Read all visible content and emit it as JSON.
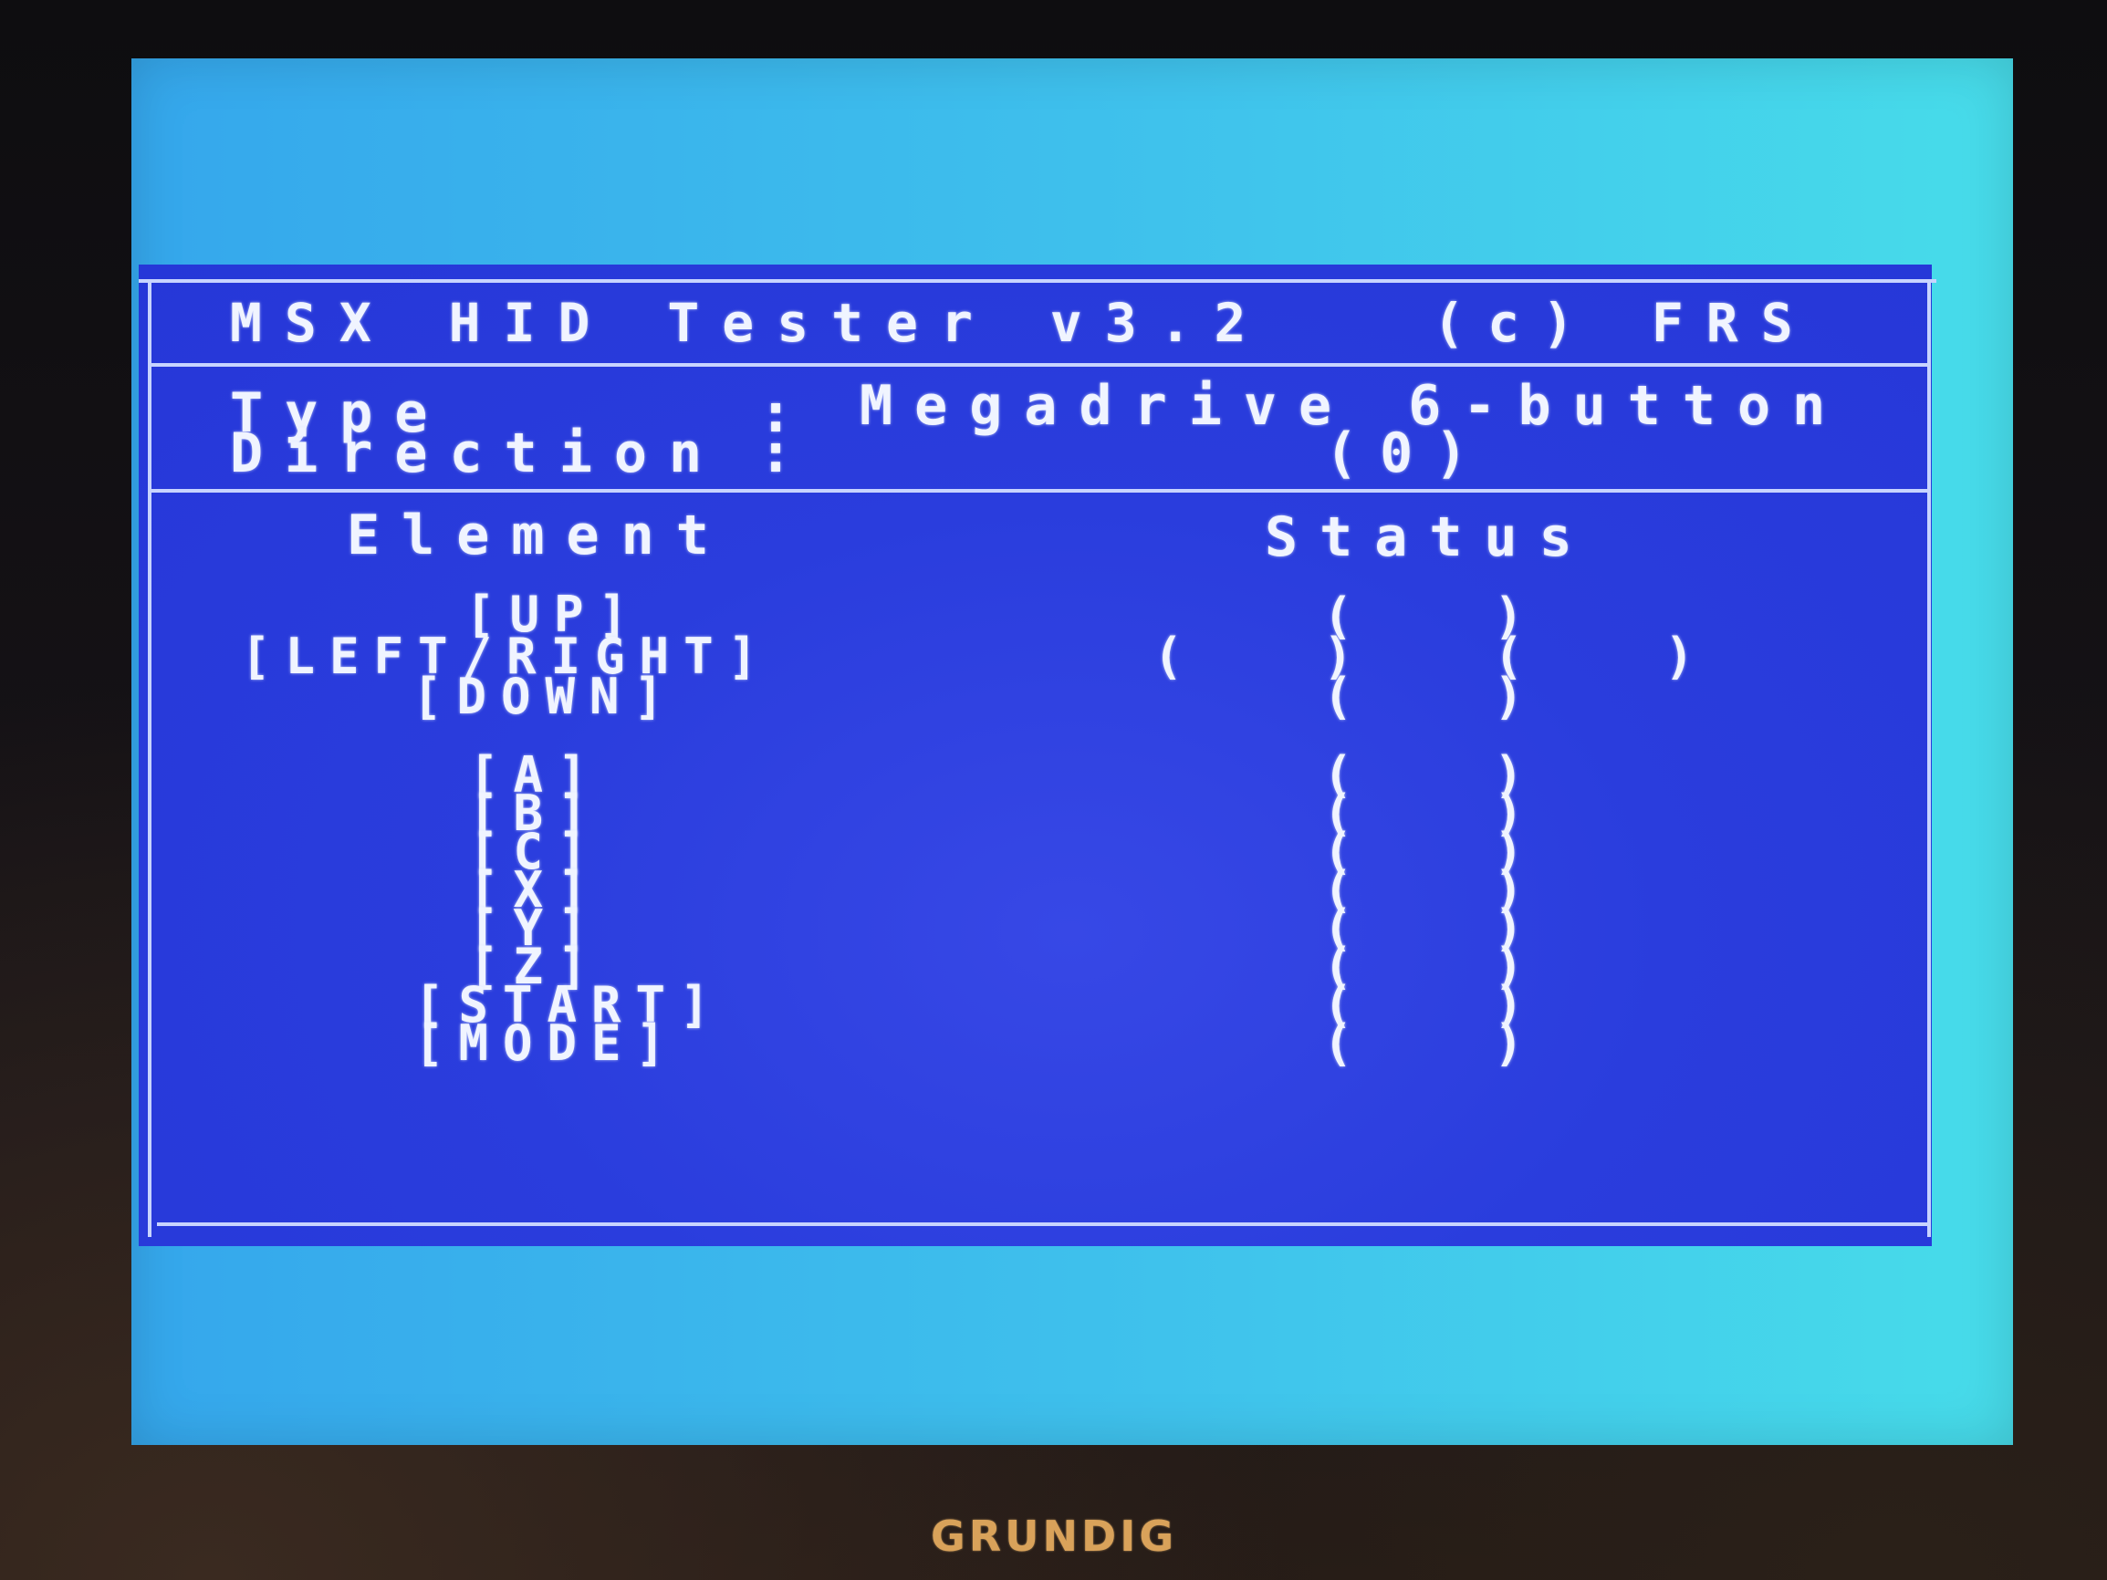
{
  "screen": {
    "title": "MSX HID Tester v3.2   (c) FRS",
    "type_label": "Type",
    "type_sep": ":",
    "type_value": "Megadrive 6-button",
    "direction_label": "Direction",
    "direction_sep": ":",
    "direction_value": "(0)",
    "header_element": "Element",
    "header_status": "Status"
  },
  "directions": {
    "up": "[UP]",
    "left_right": "[LEFT/RIGHT]",
    "down": "[DOWN]",
    "up_status_open": "(",
    "up_status_close": ")",
    "lr_status_outer_open": "(",
    "lr_status_inner_close": ")",
    "lr_status_inner_open": "(",
    "lr_status_outer_close": ")",
    "down_status_open": "(",
    "down_status_close": ")"
  },
  "buttons": [
    {
      "label": "[A]",
      "open": "(",
      "close": ")"
    },
    {
      "label": "[B]",
      "open": "(",
      "close": ")"
    },
    {
      "label": "[C]",
      "open": "(",
      "close": ")"
    },
    {
      "label": "[X]",
      "open": "(",
      "close": ")"
    },
    {
      "label": "[Y]",
      "open": "(",
      "close": ")"
    },
    {
      "label": "[Z]",
      "open": "(",
      "close": ")"
    },
    {
      "label": "[START]",
      "open": "(",
      "close": ")"
    },
    {
      "label": "[MODE]",
      "open": "(",
      "close": ")"
    }
  ],
  "monitor": {
    "brand": "GRUNDIG"
  },
  "colors": {
    "panel": "#2c3fe0",
    "border": "#35a7ec",
    "text": "#f0f4ff"
  }
}
